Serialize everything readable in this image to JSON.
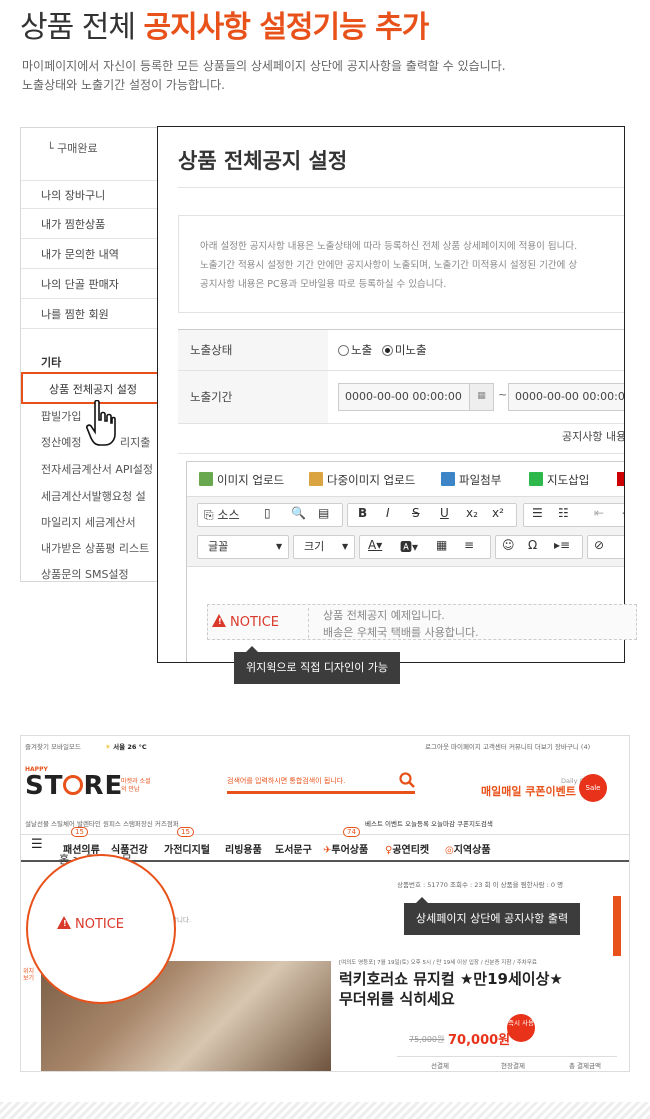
{
  "header": {
    "title_plain": "상품 전체",
    "title_highlight": "공지사항 설정기능 추가",
    "desc_line1": "마이페이지에서 자신이 등록한 모든 상품들의 상세페이지 상단에 공지사항을 출력할 수 있습니다.",
    "desc_line2": "노출상태와 노출기간 설정이 가능합니다."
  },
  "colors": {
    "accent": "#e8521a",
    "notice_red": "#d9382a",
    "tooltip_bg": "#3c3c3c"
  },
  "sidebar": {
    "sub_item": "└ 구매완료",
    "items": [
      "나의 장바구니",
      "내가 찜한상품",
      "내가 문의한 내역",
      "나의 단골 판매자",
      "나를 찜한 회원"
    ],
    "section_label": "기타",
    "selected": "상품 전체공지 설정",
    "others": [
      "팝빌가입",
      "정산예정",
      "리지출",
      "전자세금계산서 API설정",
      "세금계산서발행요청 설",
      "마일리지 세금계산서",
      "내가받은 상품평 리스트",
      "상품문의 SMS설정"
    ]
  },
  "panel": {
    "title": "상품 전체공지 설정",
    "info_lines": [
      "아래 설정한 공지사항 내용은 노출상태에 따라 등록하신 전체 상품 상세페이지에 적용이 됩니다.",
      "노출기간 적용시 설정한 기간 안에만 공지사항이 노출되며, 노출기간 미적용시 설정된 기간에 상",
      "공지사항 내용은 PC용과 모바일용 따로 등록하실 수 있습니다."
    ],
    "status_label": "노출상태",
    "status_options": [
      "노출",
      "미노출"
    ],
    "status_selected": "미노출",
    "period_label": "노출기간",
    "date_from": "0000-00-00 00:00:00",
    "date_to": "0000-00-00 00:00:00",
    "period_sep": "~",
    "content_label": "공지사항 내용"
  },
  "editor": {
    "uploads": [
      "이미지 업로드",
      "다중이미지 업로드",
      "파일첨부",
      "지도삽입"
    ],
    "source_label": "소스",
    "font_select": "글꼴",
    "size_select": "크기",
    "notice_label": "NOTICE",
    "notice_line1": "상품 전체공지 예제입니다.",
    "notice_line2": "배송은 우체국 택배를 사용합니다."
  },
  "tooltip1": "위지윅으로 직접 디자인이 가능",
  "tooltip2": "상세페이지 상단에 공지사항 출력",
  "store": {
    "top_left": "즐겨찾기  모바일모드",
    "weather": "서울 26 °C",
    "top_right": "로그아웃  마이페이지  고객센터  커뮤니티  더보기  장바구니 (4)",
    "happy": "HAPPY",
    "logo_a": "ST",
    "logo_b": "RE",
    "tagline": "마켓과 소셜의 만남",
    "search_placeholder": "검색어를 입력하시면 통합검색이 됩니다.",
    "daily": "Daily Coupon",
    "coupon": "매일매일 쿠폰이벤트",
    "subnav": "설날선물  스틸체어  발렌타인  원피스  스탬퍼장신  커즈점퍼",
    "subnav_right": "베스트  이벤트  오늘등록  오늘마감  쿠폰지도검색",
    "nav": [
      "패션의류",
      "식품건강",
      "가전디지털",
      "리빙용품",
      "도서문구",
      "투어상품",
      "공연티켓",
      "지역상품"
    ],
    "nav_badges": [
      "15",
      "15",
      "74"
    ],
    "crumb": "홈 > 공연 > 뮤",
    "meta": "상품번호 : 51770   조회수 : 23 회   이 상품을 찜한사람 : 0 명",
    "notice": "NOTICE",
    "notice_tail": "합니다.",
    "category": "[여의도 영등포] 7월 19일(토) 오후 5시 / 만 19세 이상 입장 / 신분증 지참 / 주차무료",
    "product_line1": "럭키호러쇼 뮤지컬 ★만19세이상★",
    "product_line2": "무더위를 식히세요",
    "original_price": "75,000원",
    "price": "70,000원",
    "badge": "즉시 사용",
    "cols": [
      "선결제",
      "현장결제",
      "총 결제금액"
    ],
    "side_label": "위치 보기"
  }
}
